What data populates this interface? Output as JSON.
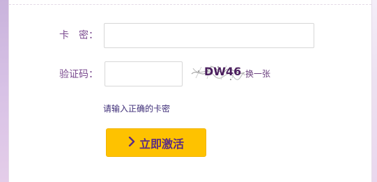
{
  "form": {
    "card_label": "卡　密：",
    "card_value": "",
    "captcha_label": "验证码：",
    "captcha_value": "",
    "captcha_text": "DW46",
    "refresh_link": "换一张",
    "error_message": "请输入正确的卡密",
    "activate_button": "立即激活"
  },
  "colors": {
    "label": "#7a4a8f",
    "button_bg": "#fec200",
    "button_text": "#5a2b83",
    "error_text": "#3d2c77"
  },
  "icons": {
    "button_icon": "chevron-right-icon"
  }
}
